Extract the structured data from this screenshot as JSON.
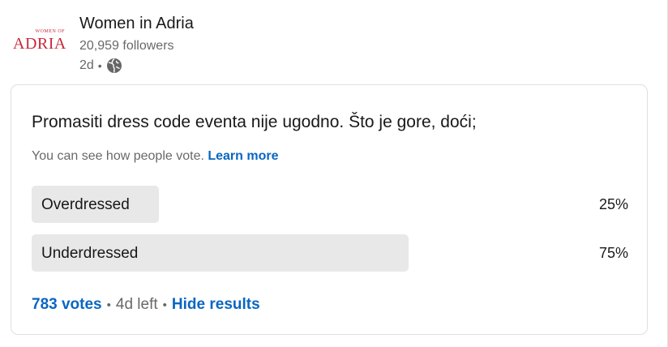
{
  "post": {
    "company_name": "Women in Adria",
    "followers": "20,959 followers",
    "time_ago": "2d",
    "logo": {
      "top": "WOMEN OF",
      "main": "ADRIA"
    },
    "visibility_icon": "globe-icon"
  },
  "poll": {
    "question": "Promasiti dress code eventa nije ugodno. Što je gore, doći;",
    "visibility_note": "You can see how people vote.",
    "learn_more": "Learn more",
    "options": [
      {
        "label": "Overdressed",
        "percent_text": "25%",
        "percent": 25
      },
      {
        "label": "Underdressed",
        "percent_text": "75%",
        "percent": 75
      }
    ],
    "votes": "783 votes",
    "time_left": "4d left",
    "hide_results": "Hide results"
  },
  "colors": {
    "link": "#0a66c2",
    "bar": "#e8e8e8",
    "logo": "#c8283a"
  }
}
